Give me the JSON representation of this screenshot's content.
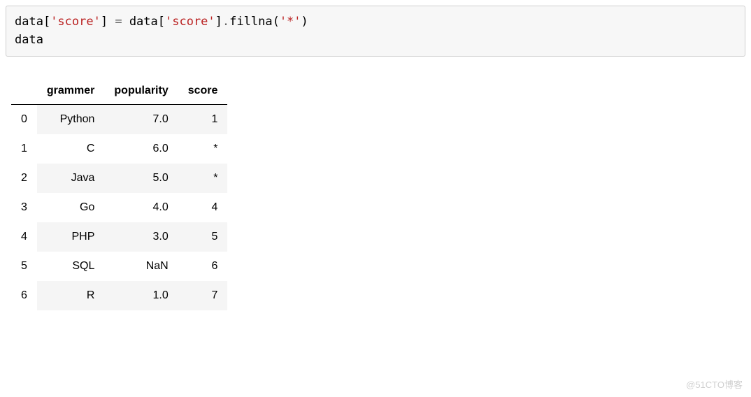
{
  "code": {
    "line1": {
      "p1": "data[",
      "str1": "'score'",
      "p2": "] ",
      "op": "=",
      "p3": " data[",
      "str2": "'score'",
      "p4": "]",
      "dot": ".",
      "fn": "fillna(",
      "str3": "'*'",
      "p5": ")"
    },
    "line2": "data"
  },
  "table": {
    "columns": [
      "grammer",
      "popularity",
      "score"
    ],
    "index": [
      "0",
      "1",
      "2",
      "3",
      "4",
      "5",
      "6"
    ],
    "rows": [
      [
        "Python",
        "7.0",
        "1"
      ],
      [
        "C",
        "6.0",
        "*"
      ],
      [
        "Java",
        "5.0",
        "*"
      ],
      [
        "Go",
        "4.0",
        "4"
      ],
      [
        "PHP",
        "3.0",
        "5"
      ],
      [
        "SQL",
        "NaN",
        "6"
      ],
      [
        "R",
        "1.0",
        "7"
      ]
    ]
  },
  "watermark": "@51CTO博客"
}
